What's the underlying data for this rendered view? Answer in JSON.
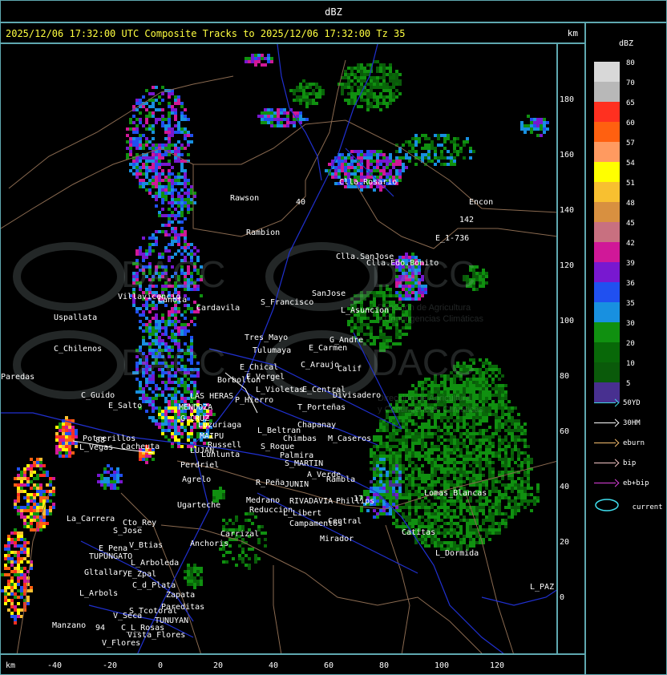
{
  "window": {
    "title": "dBZ"
  },
  "header": {
    "title": "2025/12/06 17:32:00 UTC Composite Tracks to 2025/12/06 17:32:00 Tz 35",
    "units": "km"
  },
  "axes": {
    "x_label": "km",
    "x_ticks": [
      "-40",
      "-20",
      "0",
      "20",
      "40",
      "60",
      "80",
      "100",
      "120"
    ],
    "y_ticks": [
      "180",
      "160",
      "140",
      "120",
      "100",
      "80",
      "60",
      "40",
      "20",
      "0"
    ]
  },
  "legend": {
    "title": "dBZ",
    "scale": [
      {
        "value": "80",
        "color": "#d8d8d8"
      },
      {
        "value": "70",
        "color": "#b8b8b8"
      },
      {
        "value": "65",
        "color": "#ff3020"
      },
      {
        "value": "60",
        "color": "#ff6010"
      },
      {
        "value": "57",
        "color": "#ff9a60"
      },
      {
        "value": "54",
        "color": "#ffff00"
      },
      {
        "value": "51",
        "color": "#f8c030"
      },
      {
        "value": "48",
        "color": "#d89040"
      },
      {
        "value": "45",
        "color": "#c87080"
      },
      {
        "value": "42",
        "color": "#d01898"
      },
      {
        "value": "39",
        "color": "#7818d0"
      },
      {
        "value": "36",
        "color": "#2050f0"
      },
      {
        "value": "35",
        "color": "#1890e0"
      },
      {
        "value": "30",
        "color": "#109010"
      },
      {
        "value": "20",
        "color": "#086808"
      },
      {
        "value": "10",
        "color": "#0a5a0a"
      },
      {
        "value": "5",
        "color": "#483090"
      }
    ],
    "tracks": [
      {
        "label": "50YD",
        "color": "#40d8e0"
      },
      {
        "label": "30HM",
        "color": "#ffffff"
      },
      {
        "label": "eburn",
        "color": "#f8c070"
      },
      {
        "label": "bip",
        "color": "#f8c8c8"
      },
      {
        "label": "eb+bip",
        "color": "#e040e0"
      }
    ],
    "current_label": "current"
  },
  "map": {
    "watermark": {
      "brand": "DACC",
      "line1": "Dirección de Agricultura",
      "line2": "y Contingencias Climáticas"
    },
    "places": [
      {
        "name": "Clla.Rosario"
      },
      {
        "name": "Encon"
      },
      {
        "name": "142"
      },
      {
        "name": "E_1-736"
      },
      {
        "name": "Rawson"
      },
      {
        "name": "Rambion"
      },
      {
        "name": "Clla.SanJose"
      },
      {
        "name": "Clla.Edo.Bonito"
      },
      {
        "name": "Uspallata"
      },
      {
        "name": "Villavicencio"
      },
      {
        "name": "Canota"
      },
      {
        "name": "Cardavila"
      },
      {
        "name": "S_Francisco"
      },
      {
        "name": "SanJose"
      },
      {
        "name": "L_Asuncion"
      },
      {
        "name": "C_Chilenos"
      },
      {
        "name": "Tres_Mayo"
      },
      {
        "name": "Tulumaya"
      },
      {
        "name": "E_Carmen"
      },
      {
        "name": "G_Andre"
      },
      {
        "name": "Paredas"
      },
      {
        "name": "E_Chical"
      },
      {
        "name": "E_Vergel"
      },
      {
        "name": "C_Araujo"
      },
      {
        "name": "Calif"
      },
      {
        "name": "Borbollon"
      },
      {
        "name": "L_Violetas"
      },
      {
        "name": "E_Central"
      },
      {
        "name": "Divisadero"
      },
      {
        "name": "C_Guido"
      },
      {
        "name": "E_Salto"
      },
      {
        "name": "LAS HERAS"
      },
      {
        "name": "P_Hierro"
      },
      {
        "name": "MENDOZA"
      },
      {
        "name": "G.CRUZ"
      },
      {
        "name": "T_Porteñas"
      },
      {
        "name": "Luzuriaga"
      },
      {
        "name": "L_Beltran"
      },
      {
        "name": "Chapanay"
      },
      {
        "name": "Potrerillos"
      },
      {
        "name": "Cacheuta"
      },
      {
        "name": "L_Vegas"
      },
      {
        "name": "MAIPU"
      },
      {
        "name": "Russell"
      },
      {
        "name": "LUJAN"
      },
      {
        "name": "Lunlunta"
      },
      {
        "name": "Chimbas"
      },
      {
        "name": "M_Caseros"
      },
      {
        "name": "S_Roque"
      },
      {
        "name": "Palmira"
      },
      {
        "name": "Perdriel"
      },
      {
        "name": "S_MARTIN"
      },
      {
        "name": "Agrelo"
      },
      {
        "name": "R_Peña"
      },
      {
        "name": "JUNIN"
      },
      {
        "name": "A_Verde"
      },
      {
        "name": "Rambla"
      },
      {
        "name": "Ugarteche"
      },
      {
        "name": "Medrano"
      },
      {
        "name": "RIVADAVIA"
      },
      {
        "name": "Phillips"
      },
      {
        "name": "Lomas_Blancas"
      },
      {
        "name": "Reduccion"
      },
      {
        "name": "L_Libert"
      },
      {
        "name": "Campamentos"
      },
      {
        "name": "Central"
      },
      {
        "name": "La_Carrera"
      },
      {
        "name": "Cto_Rey"
      },
      {
        "name": "S_Jose"
      },
      {
        "name": "Carrizal"
      },
      {
        "name": "Catitas"
      },
      {
        "name": "E_Pena"
      },
      {
        "name": "V_Btias"
      },
      {
        "name": "Anchoris"
      },
      {
        "name": "TUPUNGATO"
      },
      {
        "name": "Mirador"
      },
      {
        "name": "L_Dormida"
      },
      {
        "name": "L_Arboleda"
      },
      {
        "name": "Gltallary"
      },
      {
        "name": "E_Zpal"
      },
      {
        "name": "C_d_Plata"
      },
      {
        "name": "L_Arbols"
      },
      {
        "name": "Zapata"
      },
      {
        "name": "L_PAZ"
      },
      {
        "name": "S_Tcotoral"
      },
      {
        "name": "Pareditas"
      },
      {
        "name": "TUNUYAN"
      },
      {
        "name": "Manzano"
      },
      {
        "name": "C_L_Rosas"
      },
      {
        "name": "V_Flores"
      },
      {
        "name": "V_Seca"
      },
      {
        "name": "Vista_Flores"
      },
      {
        "name": "88"
      },
      {
        "name": "94"
      },
      {
        "name": "40"
      },
      {
        "name": "17"
      }
    ]
  }
}
